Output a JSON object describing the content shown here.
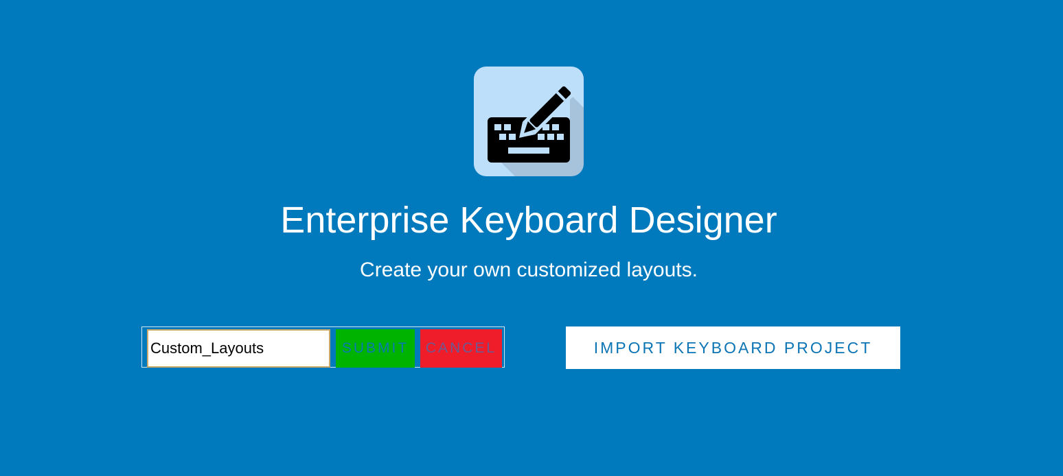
{
  "app": {
    "icon": "keyboard-edit-icon",
    "title": "Enterprise Keyboard Designer",
    "subtitle": "Create your own customized layouts."
  },
  "new_project": {
    "name_value": "Custom_Layouts",
    "submit_label": "SUBMIT",
    "cancel_label": "CANCEL"
  },
  "import_label": "IMPORT KEYBOARD PROJECT",
  "colors": {
    "background": "#0079bd",
    "icon_background": "#bddffa",
    "submit": "#00b300",
    "cancel": "#ef1c2a",
    "import_text": "#0b74b4"
  }
}
